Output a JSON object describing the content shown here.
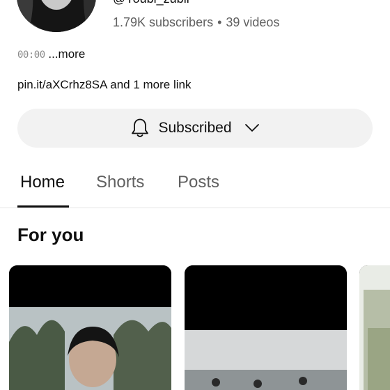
{
  "channel": {
    "handle": "@Youbi_zubil",
    "subscribers": "1.79K subscribers",
    "separator": "•",
    "videos": "39 videos",
    "description_time": "00:00",
    "description_more": " ...more",
    "links": "pin.it/aXCrhz8SA and 1 more link"
  },
  "subscribe_button": {
    "label": "Subscribed",
    "icon": "bell-icon",
    "dropdown_icon": "chevron-down-icon"
  },
  "tabs": [
    {
      "label": "Home",
      "active": true
    },
    {
      "label": "Shorts",
      "active": false
    },
    {
      "label": "Posts",
      "active": false
    }
  ],
  "section": {
    "title": "For you"
  },
  "colors": {
    "background": "#ffffff",
    "button_bg": "#f2f2f2",
    "secondary_text": "#606060",
    "primary_text": "#0f0f0f"
  }
}
